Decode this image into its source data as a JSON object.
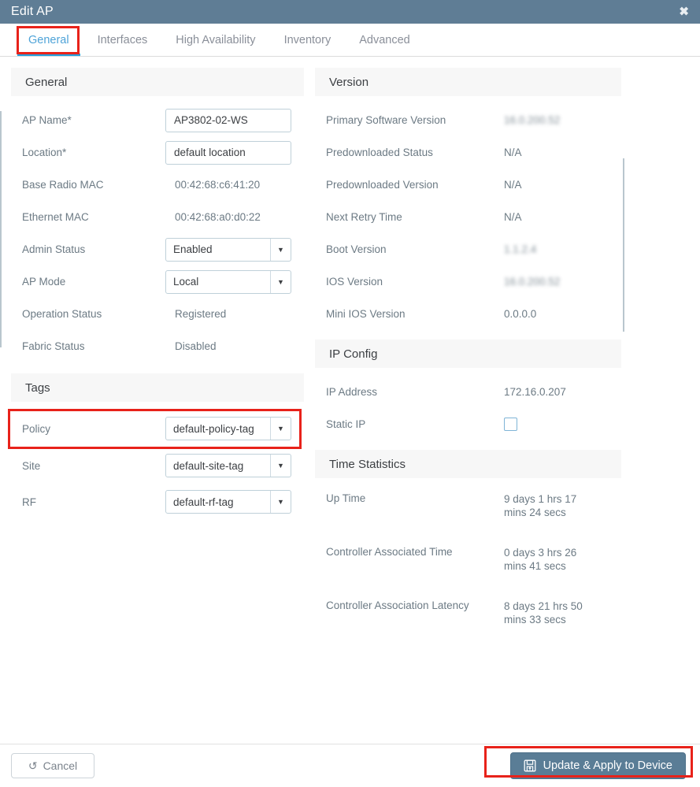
{
  "window": {
    "title": "Edit AP",
    "close_icon": "close-icon",
    "titlebar_color": "#5f7d95"
  },
  "tabs": [
    {
      "label": "General",
      "active": true
    },
    {
      "label": "Interfaces",
      "active": false
    },
    {
      "label": "High Availability",
      "active": false
    },
    {
      "label": "Inventory",
      "active": false
    },
    {
      "label": "Advanced",
      "active": false
    }
  ],
  "annotations": {
    "accent_color": "#e8221a",
    "highlighted": [
      "General tab",
      "Policy tag row",
      "Update & Apply to Device button"
    ]
  },
  "left": {
    "general": {
      "heading": "General",
      "ap_name_label": "AP Name*",
      "ap_name_value": "AP3802-02-WS",
      "location_label": "Location*",
      "location_value": "default location",
      "base_radio_mac_label": "Base Radio MAC",
      "base_radio_mac_value": "00:42:68:c6:41:20",
      "ethernet_mac_label": "Ethernet MAC",
      "ethernet_mac_value": "00:42:68:a0:d0:22",
      "admin_status_label": "Admin Status",
      "admin_status_value": "Enabled",
      "ap_mode_label": "AP Mode",
      "ap_mode_value": "Local",
      "operation_status_label": "Operation Status",
      "operation_status_value": "Registered",
      "fabric_status_label": "Fabric Status",
      "fabric_status_value": "Disabled"
    },
    "tags": {
      "heading": "Tags",
      "policy_label": "Policy",
      "policy_value": "default-policy-tag",
      "site_label": "Site",
      "site_value": "default-site-tag",
      "rf_label": "RF",
      "rf_value": "default-rf-tag"
    }
  },
  "right": {
    "version": {
      "heading": "Version",
      "primary_software_version_label": "Primary Software Version",
      "primary_software_version_value": "16.0.200.52",
      "predownloaded_status_label": "Predownloaded Status",
      "predownloaded_status_value": "N/A",
      "predownloaded_version_label": "Predownloaded Version",
      "predownloaded_version_value": "N/A",
      "next_retry_time_label": "Next Retry Time",
      "next_retry_time_value": "N/A",
      "boot_version_label": "Boot Version",
      "boot_version_value": "1.1.2.4",
      "ios_version_label": "IOS Version",
      "ios_version_value": "16.0.200.52",
      "mini_ios_version_label": "Mini IOS Version",
      "mini_ios_version_value": "0.0.0.0"
    },
    "ip_config": {
      "heading": "IP Config",
      "ip_address_label": "IP Address",
      "ip_address_value": "172.16.0.207",
      "static_ip_label": "Static IP",
      "static_ip_checked": false
    },
    "time_statistics": {
      "heading": "Time Statistics",
      "up_time_label": "Up Time",
      "up_time_value": "9 days 1 hrs 17 mins 24 secs",
      "controller_associated_time_label": "Controller Associated Time",
      "controller_associated_time_value": "0 days 3 hrs 26 mins 41 secs",
      "controller_association_latency_label": "Controller Association Latency",
      "controller_association_latency_value": "8 days 21 hrs 50 mins 33 secs"
    }
  },
  "footer": {
    "cancel_label": "Cancel",
    "cancel_icon": "undo-icon",
    "save_label": "Update & Apply to Device",
    "save_icon": "save-floppy-icon",
    "save_color": "#5a7d96"
  }
}
